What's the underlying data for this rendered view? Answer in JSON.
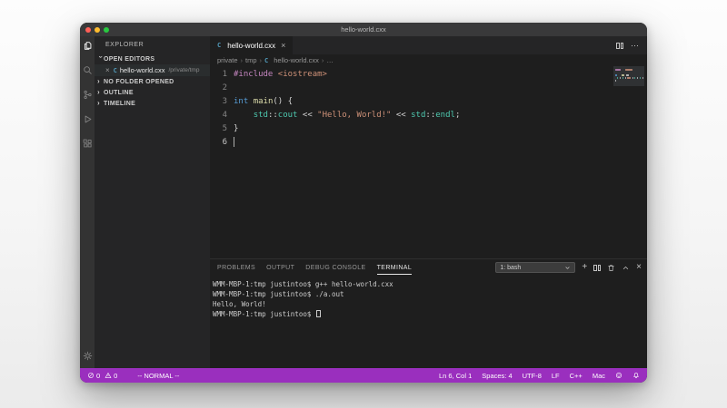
{
  "window": {
    "title": "hello-world.cxx"
  },
  "colors": {
    "status_bar": "#9A2FBE",
    "traffic_lights": [
      "#FF5F57",
      "#FEBC2E",
      "#28C840"
    ],
    "cpp_icon": "#519aba",
    "syntax": {
      "preproc": "#C586C0",
      "string": "#CE9178",
      "keyword": "#569CD6",
      "func": "#DCDCAA",
      "type": "#4EC9B0",
      "plain": "#D4D4D4"
    }
  },
  "activity_bar": {
    "icons": [
      "explorer-icon",
      "search-icon",
      "source-control-icon",
      "run-debug-icon",
      "extensions-icon",
      "settings-gear-icon"
    ]
  },
  "sidebar": {
    "title": "EXPLORER",
    "open_editors": {
      "label": "OPEN EDITORS",
      "item": {
        "file": "hello-world.cxx",
        "path": "/private/tmp",
        "close": "×",
        "icon": "C"
      }
    },
    "sections": [
      "NO FOLDER OPENED",
      "OUTLINE",
      "TIMELINE"
    ]
  },
  "editor_tab": {
    "label": "hello-world.cxx",
    "close": "×",
    "icon": "C"
  },
  "breadcrumb": {
    "items": [
      "private",
      "tmp",
      "hello-world.cxx",
      "…"
    ],
    "file_index": 2
  },
  "editor": {
    "cursor": {
      "line": 6,
      "col": 1
    },
    "lines": [
      [
        [
          "preproc",
          "#include"
        ],
        [
          "plain",
          " "
        ],
        [
          "string",
          "<iostream>"
        ]
      ],
      [],
      [
        [
          "keyword",
          "int"
        ],
        [
          "plain",
          " "
        ],
        [
          "func",
          "main"
        ],
        [
          "plain",
          "() {"
        ]
      ],
      [
        [
          "plain",
          "    "
        ],
        [
          "type",
          "std"
        ],
        [
          "plain",
          "::"
        ],
        [
          "type",
          "cout"
        ],
        [
          "plain",
          " << "
        ],
        [
          "string",
          "\"Hello, World!\""
        ],
        [
          "plain",
          " << "
        ],
        [
          "type",
          "std"
        ],
        [
          "plain",
          "::"
        ],
        [
          "type",
          "endl"
        ],
        [
          "plain",
          ";"
        ]
      ],
      [
        [
          "plain",
          "}"
        ]
      ],
      []
    ]
  },
  "panel": {
    "tabs": [
      "PROBLEMS",
      "OUTPUT",
      "DEBUG CONSOLE",
      "TERMINAL"
    ],
    "active_tab": "TERMINAL",
    "shell_select": "1: bash",
    "action_icons": [
      "new-terminal-icon",
      "split-terminal-icon",
      "kill-terminal-icon",
      "maximize-panel-icon",
      "close-panel-icon"
    ],
    "terminal_lines": [
      "WMM-MBP-1:tmp justintoo$ g++ hello-world.cxx",
      "WMM-MBP-1:tmp justintoo$ ./a.out",
      "Hello, World!",
      "WMM-MBP-1:tmp justintoo$ "
    ]
  },
  "status_bar": {
    "errors": "0",
    "warnings": "0",
    "mode": "-- NORMAL --",
    "right_items": [
      "Ln 6, Col 1",
      "Spaces: 4",
      "UTF-8",
      "LF",
      "C++",
      "Mac"
    ]
  }
}
